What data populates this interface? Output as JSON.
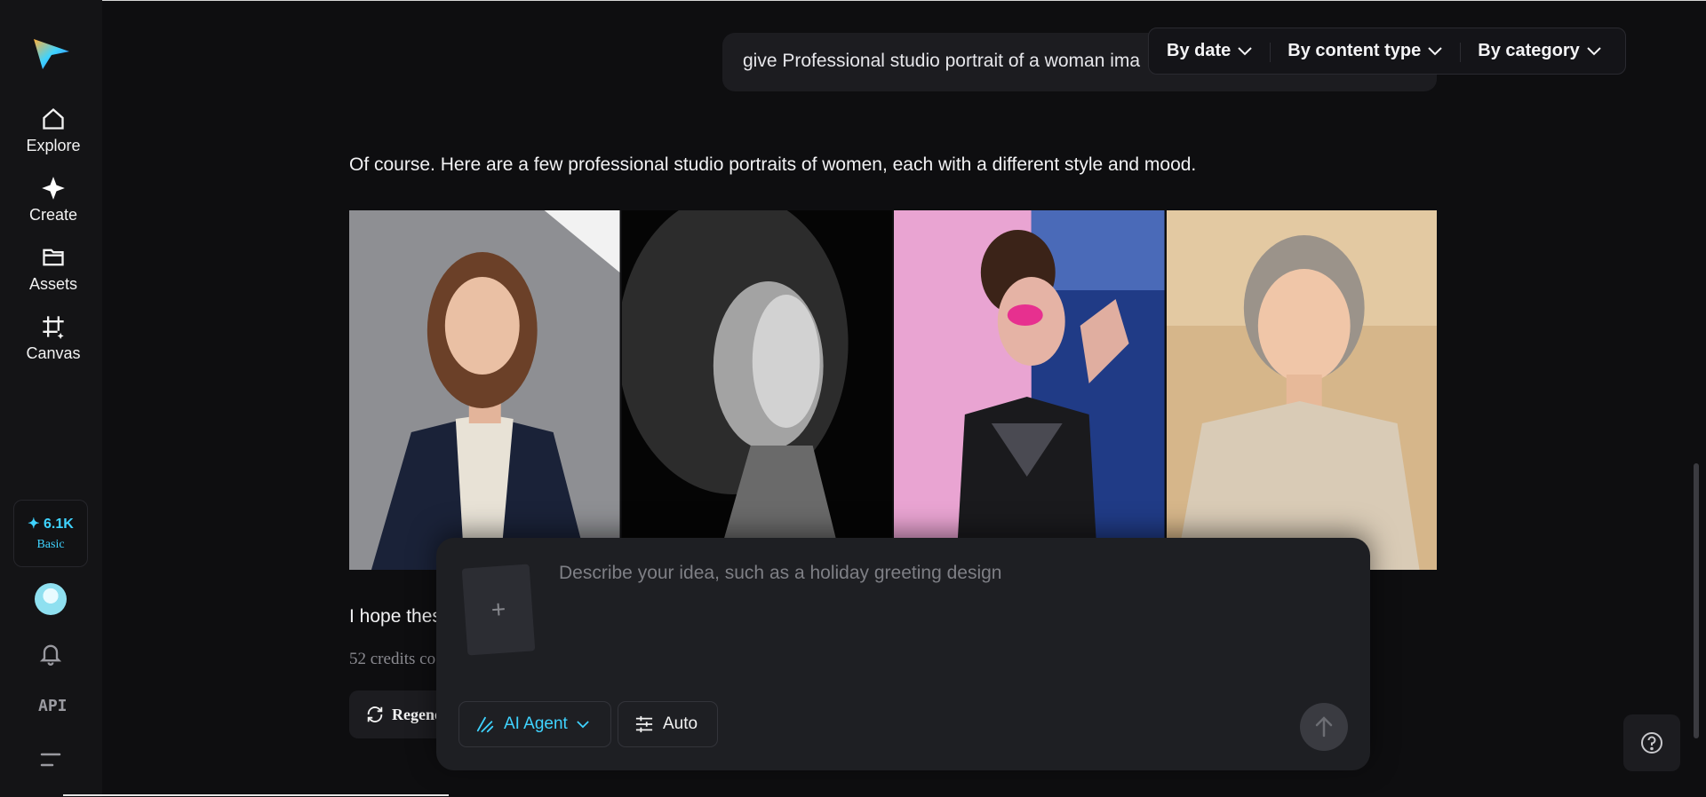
{
  "sidebar": {
    "nav": [
      {
        "label": "Explore",
        "icon": "home-icon"
      },
      {
        "label": "Create",
        "icon": "sparkle-icon"
      },
      {
        "label": "Assets",
        "icon": "folder-icon"
      },
      {
        "label": "Canvas",
        "icon": "canvas-icon"
      }
    ],
    "credits": {
      "count": "✦ 6.1K",
      "plan": "Basic"
    },
    "api_label": "API"
  },
  "filters": [
    {
      "label": "By date"
    },
    {
      "label": "By content type"
    },
    {
      "label": "By category"
    }
  ],
  "chat": {
    "user_prompt": "give Professional studio portrait of a woman ima",
    "reply": "Of course. Here are a few professional studio portraits of women, each with a different style and mood.",
    "closing": "I hope thes",
    "credits_consumed": "52 credits co",
    "regenerate_label": "Regene"
  },
  "composer": {
    "placeholder": "Describe your idea, such as a holiday greeting design",
    "upload_symbol": "+",
    "agent_label": "AI Agent",
    "auto_label": "Auto"
  },
  "colors": {
    "accent": "#3fd3ff",
    "background": "#0e0e10"
  }
}
